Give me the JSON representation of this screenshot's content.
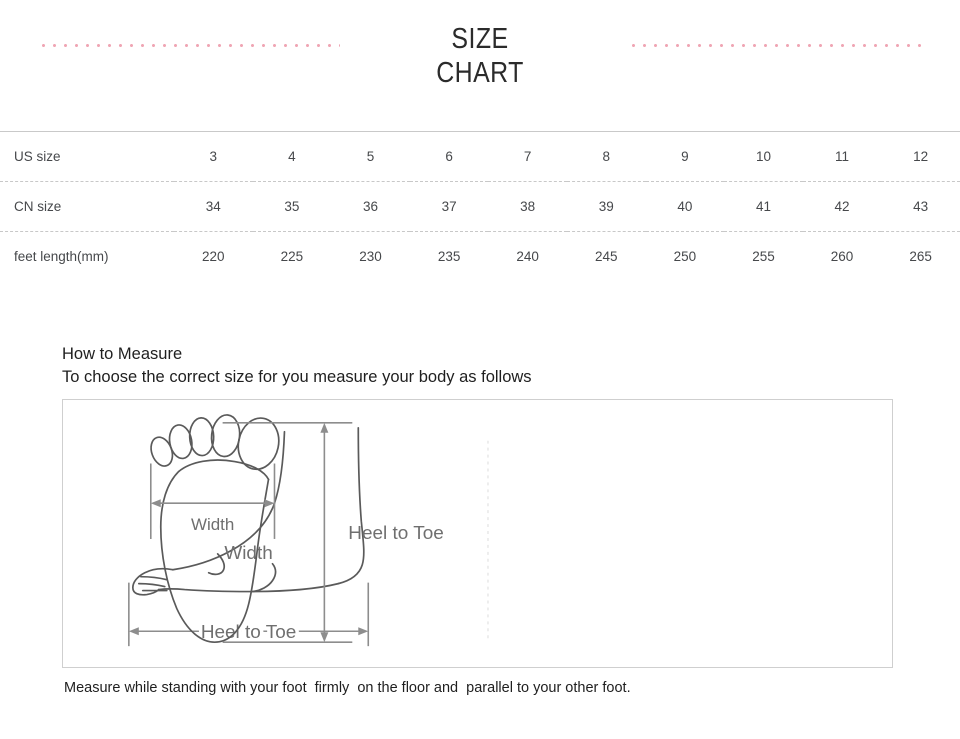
{
  "header": {
    "title_line1": "SIZE",
    "title_line2": "CHART",
    "rule_color": "#efa6b4"
  },
  "chart_data": {
    "type": "table",
    "title": "SIZE CHART",
    "row_labels": [
      "US size",
      "CN size",
      "feet length(mm)"
    ],
    "rows": [
      {
        "label": "US size",
        "values": [
          "3",
          "4",
          "5",
          "6",
          "7",
          "8",
          "9",
          "10",
          "11",
          "12"
        ]
      },
      {
        "label": "CN size",
        "values": [
          "34",
          "35",
          "36",
          "37",
          "38",
          "39",
          "40",
          "41",
          "42",
          "43"
        ]
      },
      {
        "label": "feet length(mm)",
        "values": [
          "220",
          "225",
          "230",
          "235",
          "240",
          "245",
          "250",
          "255",
          "260",
          "265"
        ]
      }
    ],
    "columns": 10,
    "grid": "dashed-row-separators",
    "xlabel": "",
    "ylabel": ""
  },
  "howto": {
    "heading": "How to Measure",
    "subheading": "To choose the correct size for you measure your body as follows"
  },
  "diagram": {
    "left_width_label": "Width",
    "left_heel_label": "Heel to Toe",
    "right_width_label": "Width",
    "right_heel_label": "Heel to Toe"
  },
  "footer": {
    "note": "Measure while standing with your foot  firmly  on the floor and  parallel to your other foot."
  }
}
